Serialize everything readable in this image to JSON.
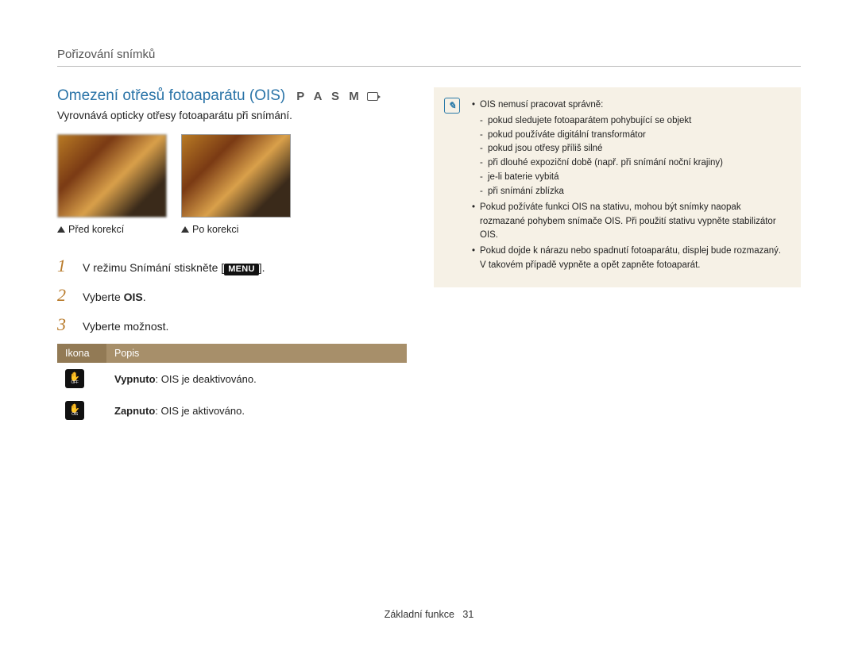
{
  "breadcrumb": "Pořizování snímků",
  "heading": "Omezení otřesů fotoaparátu (OIS)",
  "modes": "P A S M",
  "subheading": "Vyrovnává opticky otřesy fotoaparátu při snímání.",
  "captions": {
    "before": "Před korekcí",
    "after": "Po korekci"
  },
  "steps": {
    "s1_pre": "V režimu Snímání stiskněte [",
    "s1_menu": "MENU",
    "s1_post": "].",
    "s2_pre": "Vyberte ",
    "s2_bold": "OIS",
    "s2_post": ".",
    "s3": "Vyberte možnost."
  },
  "step_nums": {
    "n1": "1",
    "n2": "2",
    "n3": "3"
  },
  "table": {
    "col_icon": "Ikona",
    "col_desc": "Popis",
    "rows": [
      {
        "sub": "OFF",
        "bold": "Vypnuto",
        "rest": ": OIS je deaktivováno."
      },
      {
        "sub": "OIS",
        "bold": "Zapnuto",
        "rest": ": OIS je aktivováno."
      }
    ]
  },
  "notes": {
    "b1": "OIS nemusí pracovat správně:",
    "b1_items": [
      "pokud sledujete fotoaparátem pohybující se objekt",
      "pokud používáte digitální transformátor",
      "pokud jsou otřesy příliš silné",
      "při dlouhé expoziční době (např. při snímání noční krajiny)",
      "je-li baterie vybitá",
      "při snímání zblízka"
    ],
    "b2": "Pokud požíváte funkci OIS na stativu, mohou být snímky naopak rozmazané pohybem snímače OIS. Při použití stativu vypněte stabilizátor OIS.",
    "b3": "Pokud dojde k nárazu nebo spadnutí fotoaparátu, displej bude rozmazaný. V takovém případě vypněte a opět zapněte fotoaparát."
  },
  "footer": {
    "section": "Základní funkce",
    "page": "31"
  }
}
